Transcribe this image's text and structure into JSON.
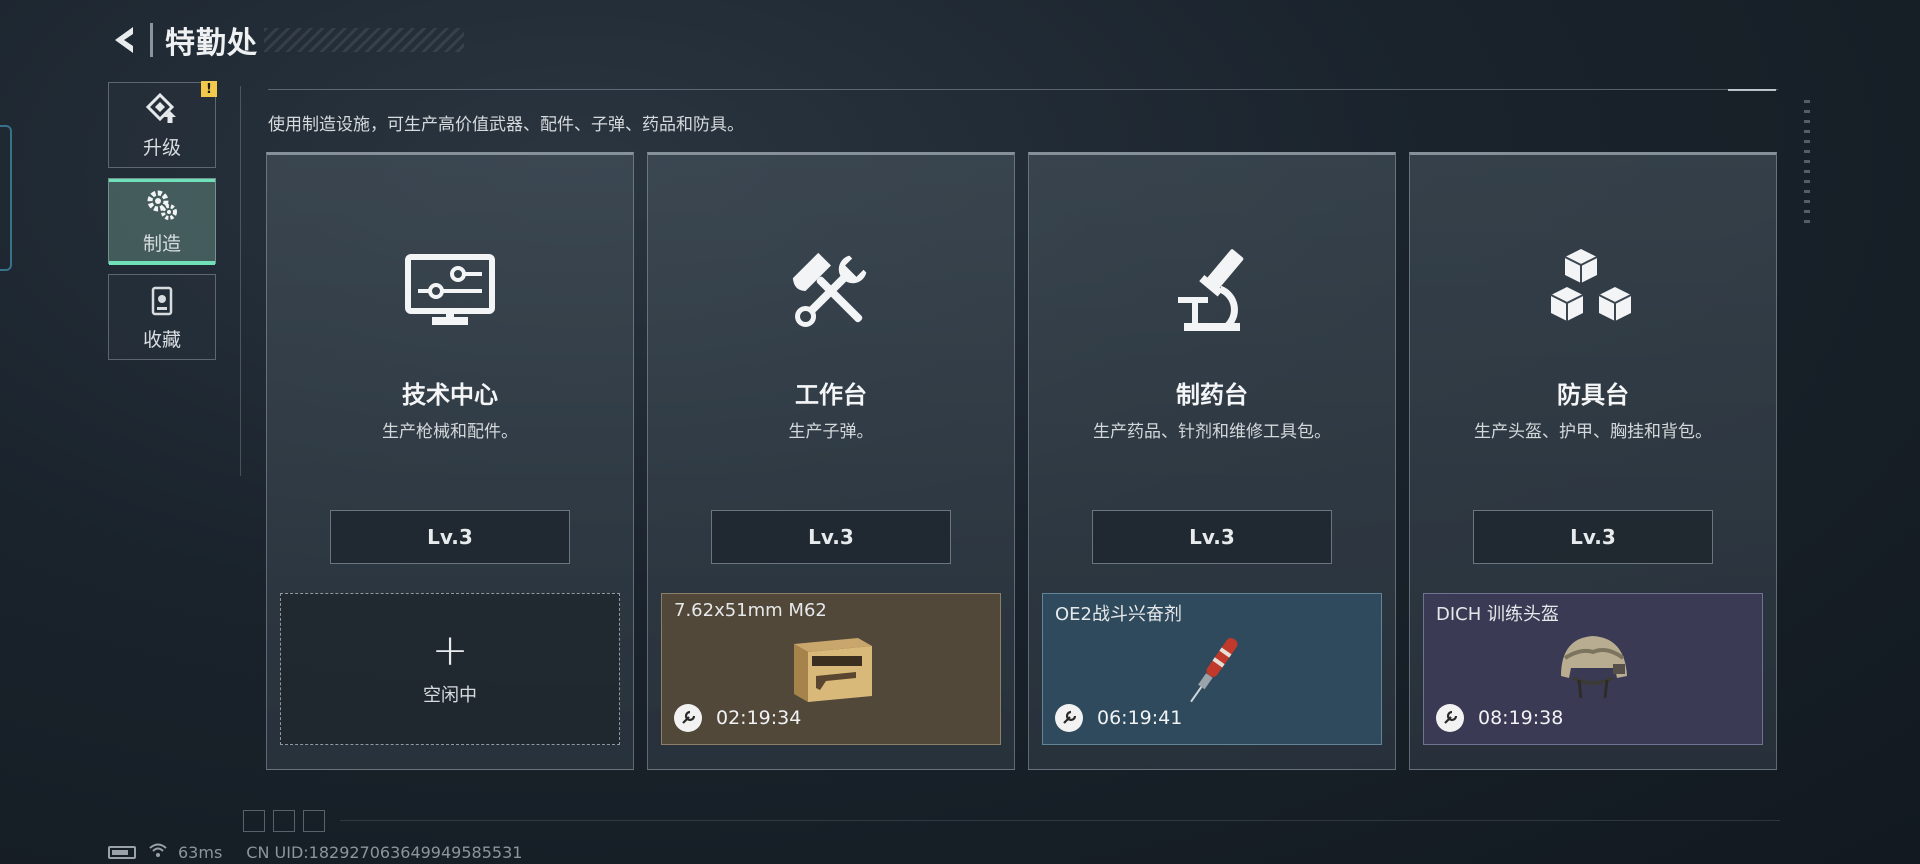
{
  "header": {
    "title": "特勤处"
  },
  "sidenav": {
    "items": [
      {
        "label": "升级",
        "icon": "upgrade-icon",
        "badge": "!"
      },
      {
        "label": "制造",
        "icon": "gears-icon",
        "active": true
      },
      {
        "label": "收藏",
        "icon": "collection-icon"
      }
    ]
  },
  "description": "使用制造设施，可生产高价值武器、配件、子弹、药品和防具。",
  "stations": [
    {
      "title": "技术中心",
      "desc": "生产枪械和配件。",
      "level": "Lv.3",
      "icon": "monitor-circuit-icon",
      "slot": {
        "state": "idle",
        "plus": "+",
        "label": "空闲中"
      }
    },
    {
      "title": "工作台",
      "desc": "生产子弹。",
      "level": "Lv.3",
      "icon": "hammer-wrench-icon",
      "slot": {
        "state": "crafting",
        "item": "7.62x51mm M62",
        "timer": "02:19:34",
        "color": "#52483a"
      }
    },
    {
      "title": "制药台",
      "desc": "生产药品、针剂和维修工具包。",
      "level": "Lv.3",
      "icon": "microscope-icon",
      "slot": {
        "state": "crafting",
        "item": "OE2战斗兴奋剂",
        "timer": "06:19:41",
        "color": "#2f4a5c"
      }
    },
    {
      "title": "防具台",
      "desc": "生产头盔、护甲、胸挂和背包。",
      "level": "Lv.3",
      "icon": "cubes-icon",
      "slot": {
        "state": "crafting",
        "item": "DICH 训练头盔",
        "timer": "08:19:38",
        "color": "#3a3a55"
      }
    }
  ],
  "status": {
    "ping": "63ms",
    "uid": "CN UID:182927063649949585531"
  }
}
